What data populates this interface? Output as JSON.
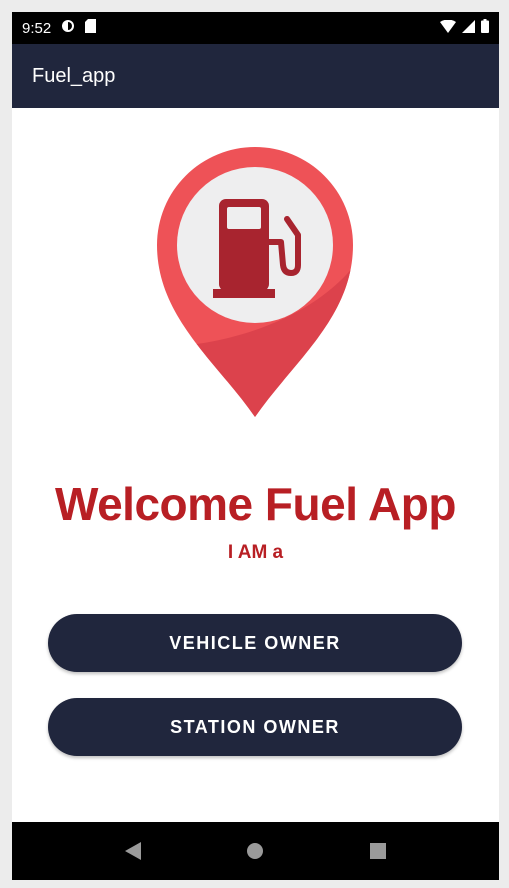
{
  "status_bar": {
    "time": "9:52"
  },
  "app_bar": {
    "title": "Fuel_app"
  },
  "main": {
    "welcome_title": "Welcome Fuel App",
    "subtitle": "I AM a",
    "buttons": {
      "vehicle_owner": "VEHICLE OWNER",
      "station_owner": "STATION OWNER"
    }
  },
  "colors": {
    "primary_dark": "#20263d",
    "accent_red": "#b81f24",
    "logo_red": "#e94a4f",
    "logo_inner": "#eeeeef"
  },
  "icons": {
    "status_left": [
      "settings-sync-icon",
      "sd-card-icon"
    ],
    "status_right": [
      "wifi-icon",
      "signal-icon",
      "battery-icon"
    ],
    "logo": "fuel-pump-pin-icon",
    "nav": [
      "back-icon",
      "home-icon",
      "recents-icon"
    ]
  }
}
